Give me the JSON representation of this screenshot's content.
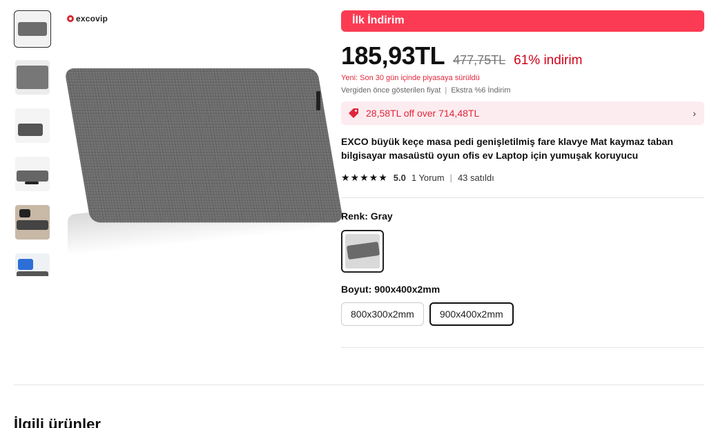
{
  "brand": {
    "name": "excovip",
    "logo_color": "#d8262e"
  },
  "thumbnails": [
    {
      "label": "thumbnail-1",
      "active": true
    },
    {
      "label": "thumbnail-2",
      "active": false
    },
    {
      "label": "thumbnail-3",
      "active": false
    },
    {
      "label": "thumbnail-4",
      "active": false
    },
    {
      "label": "thumbnail-5",
      "active": false
    },
    {
      "label": "thumbnail-6",
      "active": false
    }
  ],
  "promo": {
    "label": "İlk İndirim",
    "color": "#fb3b53"
  },
  "pricing": {
    "price": "185,93TL",
    "old_price": "477,75TL",
    "discount": "61% indirim",
    "new_notice": "Yeni: Son 30 gün içinde piyasaya sürüldü",
    "tax_note": "Vergiden önce gösterilen fiyat",
    "extra": "Ekstra %6 İndirim"
  },
  "coupon": {
    "text": "28,58TL off over 714,48TL",
    "icon": "tag-icon"
  },
  "product": {
    "title": "EXCO büyük keçe masa pedi genişletilmiş fare klavye Mat kaymaz taban bilgisayar masaüstü oyun ofis ev Laptop için yumuşak koruyucu",
    "stars": "★★★★★",
    "rating": "5.0",
    "reviews": "1 Yorum",
    "sold": "43 satıldı"
  },
  "color_option": {
    "label": "Renk: Gray",
    "selected": "Gray"
  },
  "size_option": {
    "label": "Boyut: 900x400x2mm",
    "options": [
      "800x300x2mm",
      "900x400x2mm"
    ],
    "selected": "900x400x2mm"
  },
  "related": {
    "title": "İlgili ürünler"
  }
}
